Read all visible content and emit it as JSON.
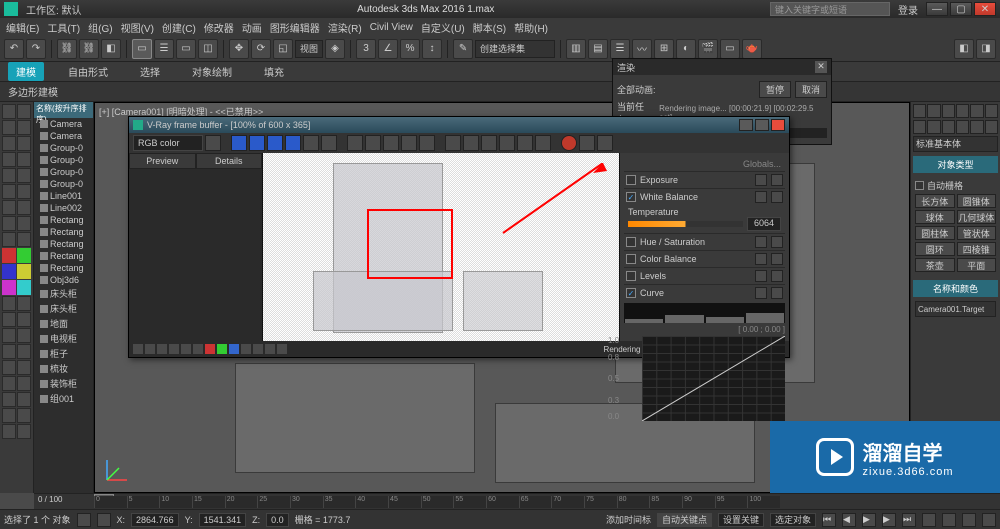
{
  "app": {
    "title": "Autodesk 3ds Max 2016    1.max",
    "workspace_label": "工作区: 默认",
    "search_placeholder": "键入关键字或短语",
    "login": "登录"
  },
  "menu": [
    "编辑(E)",
    "工具(T)",
    "组(G)",
    "视图(V)",
    "创建(C)",
    "修改器",
    "动画",
    "图形编辑器",
    "渲染(R)",
    "Civil View",
    "自定义(U)",
    "脚本(S)",
    "帮助(H)"
  ],
  "toolbar_dropdowns": {
    "snap": "视图",
    "selset": "创建选择集"
  },
  "ribbon": {
    "tabs": [
      "建模",
      "自由形式",
      "选择",
      "对象绘制",
      "填充"
    ],
    "active": 0
  },
  "subbar": {
    "section": "多边形建模"
  },
  "viewport": {
    "label": "[+] [Camera001] [明暗处理] - <<已禁用>>",
    "frame_counter": "0 / 100"
  },
  "explorer": {
    "header": "名称(按升序排序)",
    "items": [
      "Camera",
      "Camera",
      "Group-0",
      "Group-0",
      "Group-0",
      "Group-0",
      "Line001",
      "Line002",
      "Rectang",
      "Rectang",
      "Rectang",
      "Rectang",
      "Rectang",
      "Obj3d6",
      "床头柜",
      "床头柜",
      "地面",
      "电视柜",
      "柜子",
      "梳妆",
      "装饰柜",
      "组001"
    ]
  },
  "render_dialog": {
    "title": "渲染",
    "total_label": "全部动画:",
    "pause": "暂停",
    "cancel": "取消",
    "task_label": "当前任务:",
    "task_text": "Rendering image... [00:00:21.9] [00:02:29.5 est]"
  },
  "vfb": {
    "title": "V-Ray frame buffer - [100% of 600 x 365]",
    "channel": "RGB color",
    "history_tabs": [
      "Preview",
      "Details"
    ],
    "cc": {
      "globals": "Globals...",
      "exposure": "Exposure",
      "white_balance": "White Balance",
      "temperature": "Temperature",
      "temp_value": "6064",
      "hue_sat": "Hue / Saturation",
      "color_balance": "Color Balance",
      "levels": "Levels",
      "curve": "Curve",
      "coords": "[ 0.00 ; 0.00 ]",
      "ylabels": [
        "1.0",
        "0.8",
        "0.5",
        "0.3",
        "0.0"
      ]
    },
    "status": "Rendering image... [00:00:21.9] [00:02:29.5 est]"
  },
  "cmdpanel": {
    "modifier_dd": "标准基本体",
    "rollout1": "对象类型",
    "autogrid": "自动栅格",
    "primitives": [
      "长方体",
      "圆锥体",
      "球体",
      "几何球体",
      "圆柱体",
      "管状体",
      "圆环",
      "四棱锥",
      "茶壶",
      "平面"
    ],
    "rollout2": "名称和颜色",
    "name_field": "Camera001.Target"
  },
  "statusbar": {
    "sel": "选择了 1 个 对象",
    "x": "X:",
    "y": "Y:",
    "z": "Z:",
    "grid": "栅格 = 1773.7",
    "coord_hint": "2864.766",
    "c2": "1541.341",
    "c3": "0.0",
    "add_time": "添加时间标",
    "tag": "自动关键点",
    "set": "设置关键",
    "filter": "选定对象"
  },
  "watermark": {
    "brand": "溜溜自学",
    "url": "zixue.3d66.com"
  },
  "timeline_ticks": [
    "0",
    "5",
    "10",
    "15",
    "20",
    "25",
    "30",
    "35",
    "40",
    "45",
    "50",
    "55",
    "60",
    "65",
    "70",
    "75",
    "80",
    "85",
    "90",
    "95",
    "100"
  ]
}
